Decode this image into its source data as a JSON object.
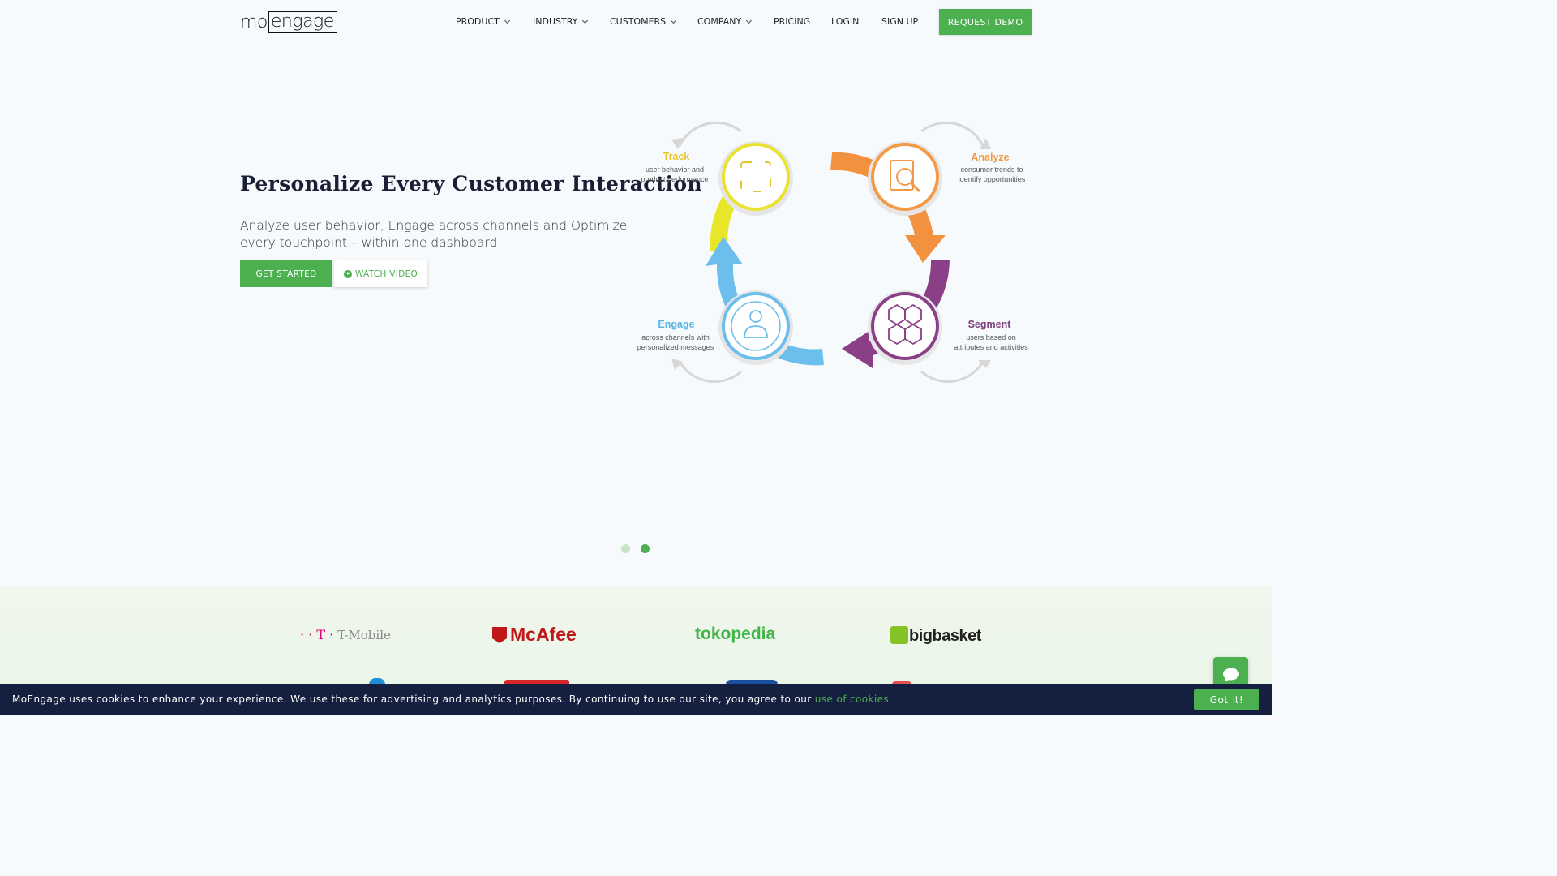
{
  "header": {
    "logo_part1": "mo",
    "logo_part2": "engage",
    "nav": [
      {
        "label": "PRODUCT",
        "dropdown": true
      },
      {
        "label": "INDUSTRY",
        "dropdown": true
      },
      {
        "label": "CUSTOMERS",
        "dropdown": true
      },
      {
        "label": "COMPANY",
        "dropdown": true
      },
      {
        "label": "PRICING",
        "dropdown": false
      },
      {
        "label": "LOGIN",
        "dropdown": false
      },
      {
        "label": "SIGN UP",
        "dropdown": false
      }
    ],
    "demo_label": "REQUEST DEMO"
  },
  "hero": {
    "title": "Personalize Every Customer Interaction",
    "subtitle": "Analyze user behavior, Engage across channels and Optimize every touchpoint – within one dashboard",
    "start_label": "GET STARTED",
    "video_label": "WATCH VIDEO",
    "diagram": {
      "track": {
        "title": "Track",
        "line1": "user behavior and",
        "line2": "product performance",
        "color": "#e6c72b"
      },
      "analyze": {
        "title": "Analyze",
        "line1": "consumer trends to",
        "line2": "identify opportunities",
        "color": "#f29a45"
      },
      "segment": {
        "title": "Segment",
        "line1": "users based on",
        "line2": "attributes and activities",
        "color": "#7d3f7c"
      },
      "engage": {
        "title": "Engage",
        "line1": "across channels with",
        "line2": "personalized messages",
        "color": "#5bb5e3"
      }
    }
  },
  "carousel": {
    "active_index": 1,
    "count": 2
  },
  "logos": {
    "row1": [
      "T-Mobile",
      "McAfee",
      "tokopedia",
      "bigbasket"
    ]
  },
  "cookie": {
    "text": "MoEngage uses cookies to enhance your experience. We use these for advertising and analytics purposes. By continuing to use our site, you agree to our ",
    "link": "use of cookies.",
    "button": "Got it!"
  },
  "colors": {
    "accent": "#4caf50",
    "cookie_bg": "#151f3f"
  }
}
